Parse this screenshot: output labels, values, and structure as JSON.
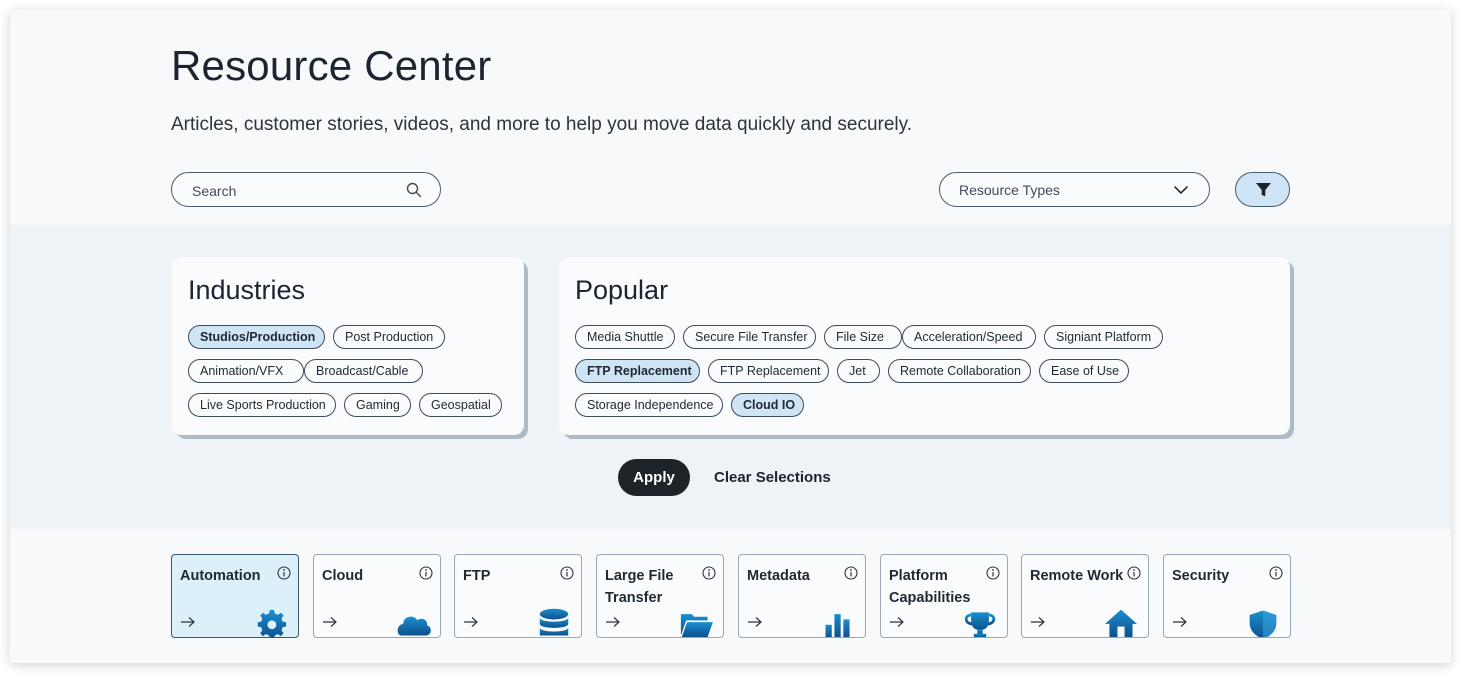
{
  "header": {
    "title": "Resource Center",
    "subtitle": "Articles, customer stories, videos, and more to help you move data quickly and securely."
  },
  "search": {
    "placeholder": "Search",
    "value": ""
  },
  "resource_types": {
    "label": "Resource Types"
  },
  "filter_button": {
    "icon": "funnel-icon",
    "active": true
  },
  "industries": {
    "title": "Industries",
    "chips": [
      {
        "label": "Studios/Production",
        "selected": true
      },
      {
        "label": "Post Production",
        "selected": false
      },
      {
        "label": "Animation/VFX",
        "selected": false
      },
      {
        "label": "Broadcast/Cable",
        "selected": false
      },
      {
        "label": "Live Sports Production",
        "selected": false
      },
      {
        "label": "Gaming",
        "selected": false
      },
      {
        "label": "Geospatial",
        "selected": false
      }
    ]
  },
  "popular": {
    "title": "Popular",
    "chips": [
      {
        "label": "Media Shuttle",
        "selected": false
      },
      {
        "label": "Secure File Transfer",
        "selected": false
      },
      {
        "label": "File Size",
        "selected": false
      },
      {
        "label": "Acceleration/Speed",
        "selected": false
      },
      {
        "label": "Signiant Platform",
        "selected": false
      },
      {
        "label": "FTP Replacement",
        "selected": true
      },
      {
        "label": "FTP Replacement",
        "selected": false
      },
      {
        "label": "Jet",
        "selected": false
      },
      {
        "label": "Remote Collaboration",
        "selected": false
      },
      {
        "label": "Ease of Use",
        "selected": false
      },
      {
        "label": "Storage Independence",
        "selected": false
      },
      {
        "label": "Cloud IO",
        "selected": true
      }
    ]
  },
  "actions": {
    "apply": "Apply",
    "clear": "Clear Selections"
  },
  "topics": [
    {
      "label": "Automation",
      "icon": "gear-icon",
      "active": true
    },
    {
      "label": "Cloud",
      "icon": "cloud-icon",
      "active": false
    },
    {
      "label": "FTP",
      "icon": "database-icon",
      "active": false
    },
    {
      "label": "Large File Transfer",
      "icon": "folder-icon",
      "active": false
    },
    {
      "label": "Metadata",
      "icon": "bar-chart-icon",
      "active": false
    },
    {
      "label": "Platform Capabilities",
      "icon": "trophy-icon",
      "active": false
    },
    {
      "label": "Remote Work",
      "icon": "home-icon",
      "active": false
    },
    {
      "label": "Security",
      "icon": "shield-icon",
      "active": false
    }
  ],
  "colors": {
    "accent": "#cfe4f5",
    "icon_gradient_start": "#1a8fd0",
    "icon_gradient_end": "#0f4f8c",
    "dark_button": "#1e232a"
  }
}
